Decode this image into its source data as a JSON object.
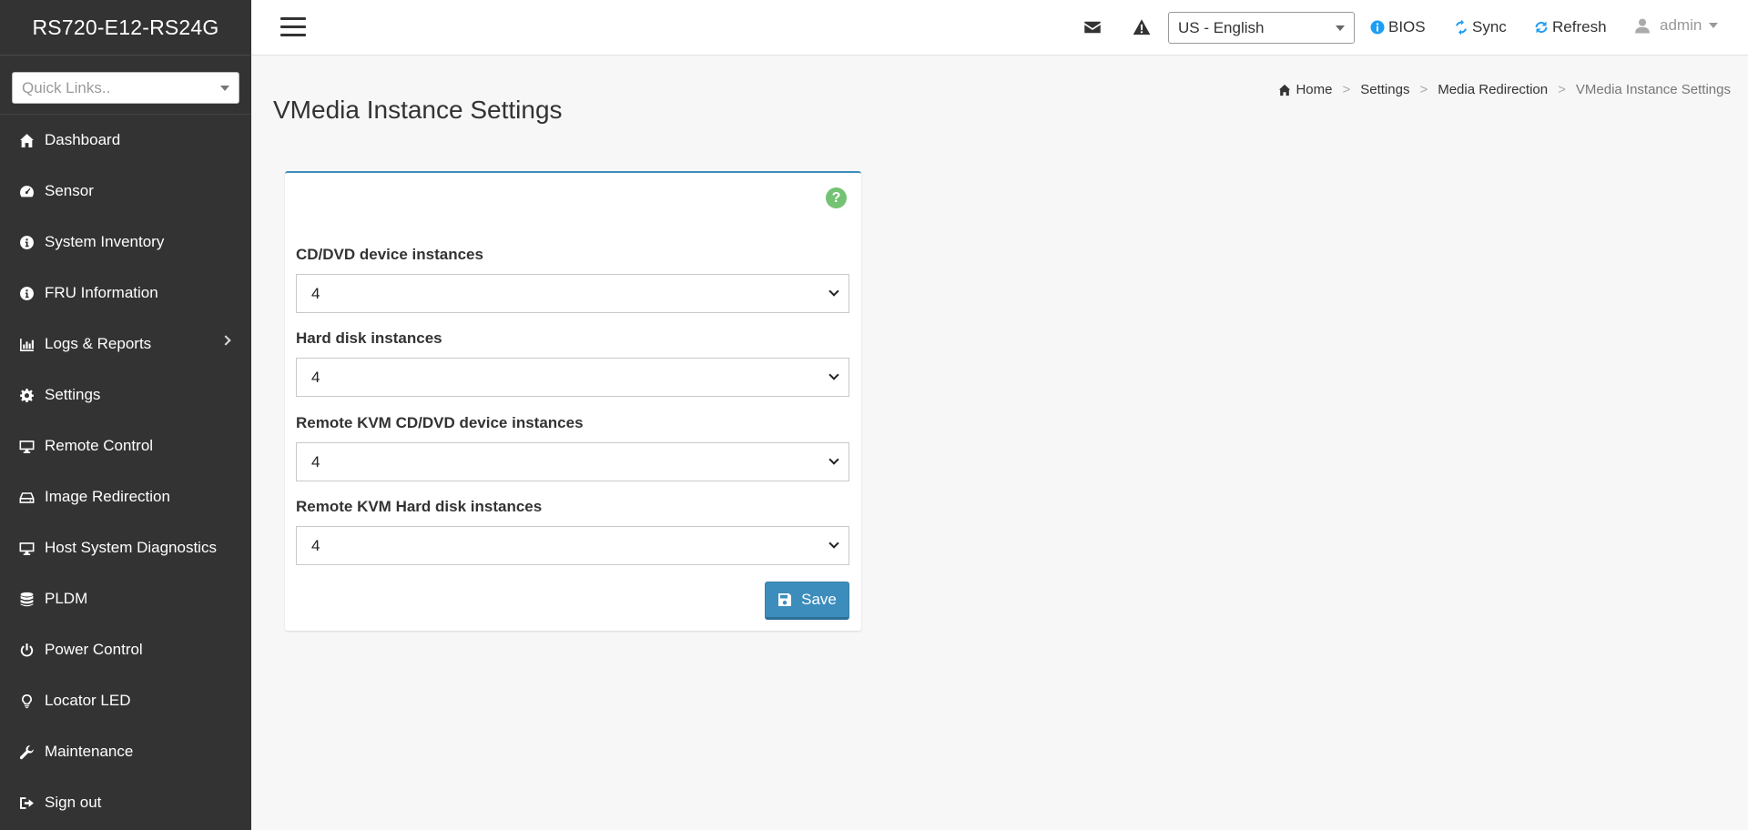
{
  "brand": "RS720-E12-RS24G",
  "quick_links": {
    "placeholder": "Quick Links.."
  },
  "sidebar": {
    "items": [
      {
        "label": "Dashboard",
        "icon": "home-icon"
      },
      {
        "label": "Sensor",
        "icon": "dashboard-gauge-icon"
      },
      {
        "label": "System Inventory",
        "icon": "info-circle-icon"
      },
      {
        "label": "FRU Information",
        "icon": "info-circle-icon"
      },
      {
        "label": "Logs & Reports",
        "icon": "bar-chart-icon",
        "has_submenu": true
      },
      {
        "label": "Settings",
        "icon": "gear-icon"
      },
      {
        "label": "Remote Control",
        "icon": "desktop-icon"
      },
      {
        "label": "Image Redirection",
        "icon": "hdd-icon"
      },
      {
        "label": "Host System Diagnostics",
        "icon": "desktop-icon"
      },
      {
        "label": "PLDM",
        "icon": "database-icon"
      },
      {
        "label": "Power Control",
        "icon": "power-icon"
      },
      {
        "label": "Locator LED",
        "icon": "lightbulb-icon"
      },
      {
        "label": "Maintenance",
        "icon": "wrench-icon"
      },
      {
        "label": "Sign out",
        "icon": "sign-out-icon"
      }
    ]
  },
  "topbar": {
    "language": "US - English",
    "bios_label": "BIOS",
    "sync_label": "Sync",
    "refresh_label": "Refresh",
    "user_label": "admin"
  },
  "page": {
    "title": "VMedia Instance Settings",
    "breadcrumb": [
      "Home",
      "Settings",
      "Media Redirection",
      "VMedia Instance Settings"
    ]
  },
  "form": {
    "fields": [
      {
        "label": "CD/DVD device instances",
        "value": "4"
      },
      {
        "label": "Hard disk instances",
        "value": "4"
      },
      {
        "label": "Remote KVM CD/DVD device instances",
        "value": "4"
      },
      {
        "label": "Remote KVM Hard disk instances",
        "value": "4"
      }
    ],
    "save_label": "Save"
  },
  "colors": {
    "sidebar_bg": "#333333",
    "accent": "#3c8dbc",
    "help": "#5cb85c",
    "info_blue": "#1e9ef3"
  }
}
